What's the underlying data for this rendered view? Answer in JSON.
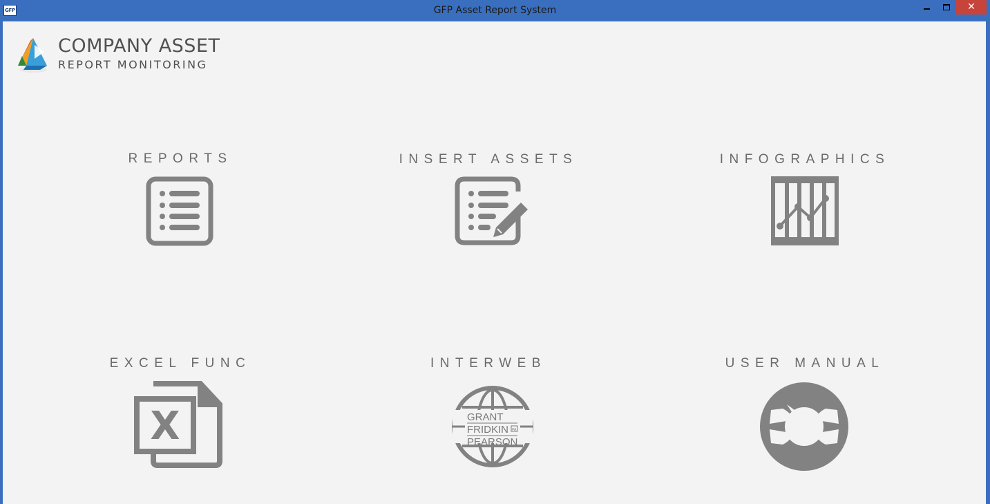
{
  "window": {
    "icon_text": "GFP",
    "title": "GFP Asset Report System",
    "close_glyph": "✕"
  },
  "header": {
    "title": "COMPANY ASSET",
    "subtitle": "REPORT MONITORING"
  },
  "tiles": [
    {
      "label": "REPORTS",
      "icon": "list-document-icon"
    },
    {
      "label": "INSERT ASSETS",
      "icon": "edit-document-icon"
    },
    {
      "label": "INFOGRAPHICS",
      "icon": "line-chart-icon"
    },
    {
      "label": "EXCEL FUNC",
      "icon": "excel-file-icon"
    },
    {
      "label": "INTERWEB",
      "icon": "globe-logo-icon"
    },
    {
      "label": "USER MANUAL",
      "icon": "lifebuoy-icon"
    }
  ],
  "interweb_logo": {
    "line1": "GRANT",
    "line2": "FRIDKIN",
    "line3": "PEARSON",
    "mark": "PA"
  },
  "colors": {
    "titlebar": "#3a6fbf",
    "close": "#c7443b",
    "background": "#f3f3f3",
    "icon_gray": "#828282",
    "text_gray": "#6a6a6a"
  }
}
